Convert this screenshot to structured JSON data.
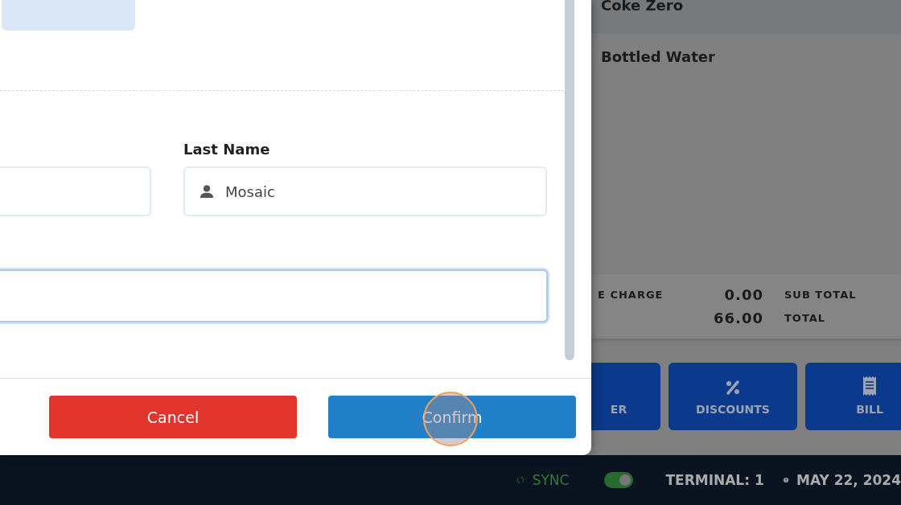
{
  "dialog": {
    "last_name": {
      "label": "Last Name",
      "value": "Mosaic"
    },
    "buttons": [
      {
        "label": "Cancel",
        "kind": "cancel"
      },
      {
        "label": "Confirm",
        "kind": "confirm"
      }
    ]
  },
  "order": {
    "items": [
      {
        "name": "Coke Zero",
        "selected": true
      },
      {
        "name": "Bottled Water",
        "selected": false
      }
    ],
    "totals": [
      {
        "label": "E CHARGE",
        "value": "0.00",
        "label_2": "SUB TOTAL"
      },
      {
        "value": "66.00",
        "label_2": "TOTAL"
      }
    ],
    "actions": [
      {
        "label": "ER",
        "kind": "none"
      },
      {
        "label": "DISCOUNTS",
        "kind": "percent"
      },
      {
        "label": "BILL",
        "kind": "receipt"
      }
    ]
  },
  "status_bar": {
    "sync": "SYNC",
    "online": true,
    "terminal": "TERMINAL: 1",
    "date": "MAY 22, 2024"
  }
}
